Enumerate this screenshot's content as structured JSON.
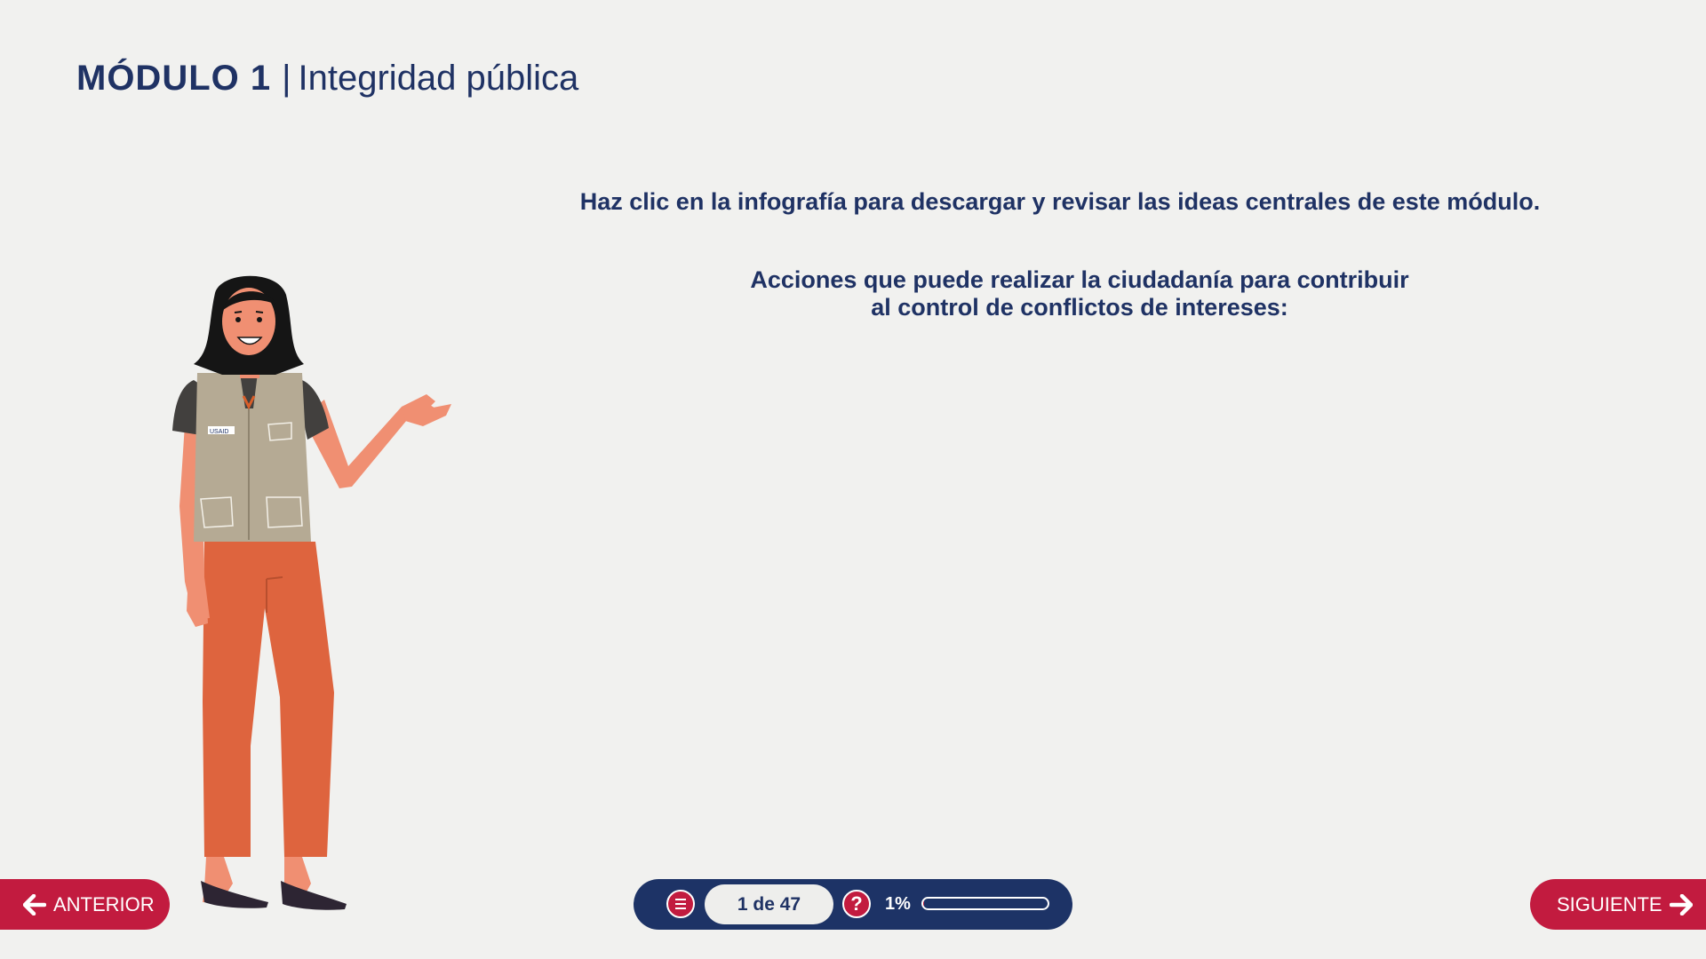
{
  "header": {
    "module": "MÓDULO 1",
    "separator": "|",
    "topic": "Integridad pública"
  },
  "main": {
    "instruction": "Haz clic en la infografía para descargar y revisar las ideas centrales de este módulo.",
    "subheading_line1": "Acciones que puede realizar la ciudadanía para contribuir",
    "subheading_line2": "al control de conflictos de intereses:"
  },
  "character": {
    "vest_badge": "USAID"
  },
  "footer": {
    "prev_label": "ANTERIOR",
    "next_label": "SIGUIENTE",
    "page_indicator": "1 de 47",
    "help_symbol": "?",
    "progress_label": "1%",
    "progress_value": 0.01
  },
  "colors": {
    "background": "#f1f1ef",
    "navy": "#1d3366",
    "accent_red": "#c21b3f",
    "skin": "#f08f72",
    "vest": "#b5aa94",
    "pants": "#de643e"
  },
  "icons": [
    "arrow-left-icon",
    "arrow-right-icon",
    "menu-icon",
    "help-icon"
  ]
}
